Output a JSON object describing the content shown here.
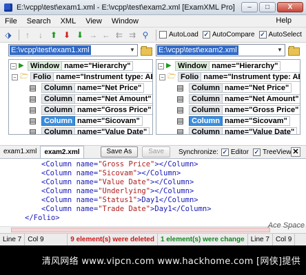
{
  "window": {
    "title": "E:\\vcpp\\test\\exam1.xml - E:\\vcpp\\test\\exam2.xml [ExamXML Pro]",
    "min_glyph": "–",
    "max_glyph": "□",
    "close_glyph": "X"
  },
  "menu": {
    "items": [
      "File",
      "Search",
      "XML",
      "View",
      "Window"
    ],
    "help": "Help"
  },
  "toolbar": {
    "checkboxes": [
      {
        "label": "AutoLoad",
        "checked": false
      },
      {
        "label": "AutoCompare",
        "checked": true
      },
      {
        "label": "AutoSelect",
        "checked": true
      }
    ]
  },
  "left": {
    "path": "E:\\vcpp\\test\\exam1.xml",
    "tree": [
      {
        "tag": "Window",
        "attr": "name=\"Hierarchy\""
      },
      {
        "tag": "Folio",
        "attr": "name=\"Instrument type: ABCI"
      },
      {
        "tag": "Column",
        "attr": "name=\"Net Price\""
      },
      {
        "tag": "Column",
        "attr": "name=\"Net Amount\""
      },
      {
        "tag": "Column",
        "attr": "name=\"Gross Price\""
      },
      {
        "tag": "Column",
        "attr": "name=\"Sicovam\""
      },
      {
        "tag": "Column",
        "attr": "name=\"Value Date\""
      }
    ]
  },
  "right": {
    "path": "E:\\vcpp\\test\\exam2.xml",
    "tree": [
      {
        "tag": "Window",
        "attr": "name=\"Hierarchy\""
      },
      {
        "tag": "Folio",
        "attr": "name=\"Instrument type: ABC"
      },
      {
        "tag": "Column",
        "attr": "name=\"Net Price\""
      },
      {
        "tag": "Column",
        "attr": "name=\"Net Amount\""
      },
      {
        "tag": "Column",
        "attr": "name=\"Gross Price\""
      },
      {
        "tag": "Column",
        "attr": "name=\"Sicovam\""
      },
      {
        "tag": "Column",
        "attr": "name=\"Value Date\""
      }
    ]
  },
  "tabs": {
    "items": [
      "exam1.xml",
      "exam2.xml"
    ],
    "active": 1,
    "save_as": "Save As",
    "save": "Save",
    "sync_label": "Synchronize:",
    "editor_check": "Editor",
    "treeview_check": "TreeView"
  },
  "editor": {
    "lines": [
      {
        "open": "<Column name=",
        "value": "\"Gross Price\"",
        "close": "></Column>"
      },
      {
        "open": "<Column name=",
        "value": "\"Sicovam\"",
        "close": "></Column>"
      },
      {
        "open": "<Column name=",
        "value": "\"Value Date\"",
        "close": "></Column>"
      },
      {
        "open": "<Column name=",
        "value": "\"Underlying\"",
        "close": "></Column>"
      },
      {
        "open": "<Column name=",
        "value": "\"Status1\"",
        "close": ">Day1</Column>"
      },
      {
        "open": "<Column name=",
        "value": "\"Trade Date\"",
        "close": ">Day1</Column>"
      }
    ],
    "closing": "</Folio>"
  },
  "status": {
    "line_left": "Line 7",
    "col_left": "Col 9",
    "deleted": "9 element(s) were deleted",
    "changed": "1 element(s) were change",
    "line_right": "Line 7",
    "col_right": "Col 9"
  },
  "watermark": "Ace Space",
  "footer": "清风网络 www.vipcn.com   www.hackhome.com [网侠]提供"
}
